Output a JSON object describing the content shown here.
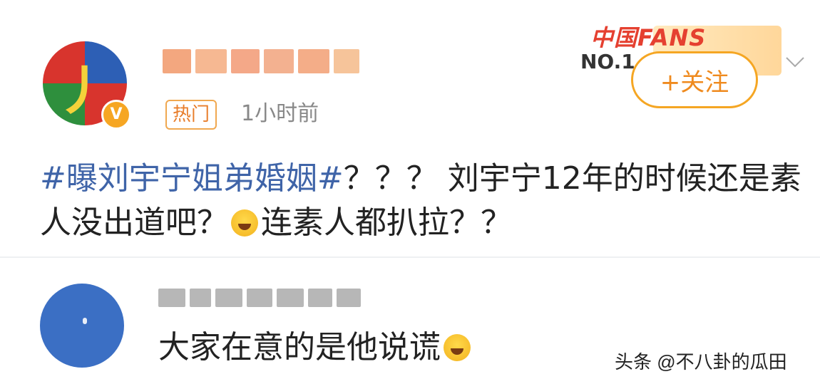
{
  "post": {
    "author_icon": "avatar-glyph",
    "verified_badge": "V",
    "hot_tag": "热门",
    "time": "1小时前",
    "fans_badge_title": "中国FANS",
    "fans_badge_rank": "NO.1",
    "follow_label": "+关注",
    "hashtag": "#曝刘宇宁姐弟婚姻#",
    "content_part1": "？？？ 刘宇宁12年的时候还是素人没出道吧？",
    "content_part2": "连素人都扒拉？？",
    "emoji_name": "laugh-cry-emoji"
  },
  "reply": {
    "text": "大家在意的是他说谎",
    "emoji_name": "laugh-cry-emoji"
  },
  "watermark": "头条 @不八卦的瓜田",
  "colors": {
    "hashtag": "#3f64a8",
    "follow_border": "#f5a623",
    "follow_text": "#ef8a1e",
    "hot_tag": "#e87d2a",
    "reply_avatar": "#3b6fc4"
  }
}
